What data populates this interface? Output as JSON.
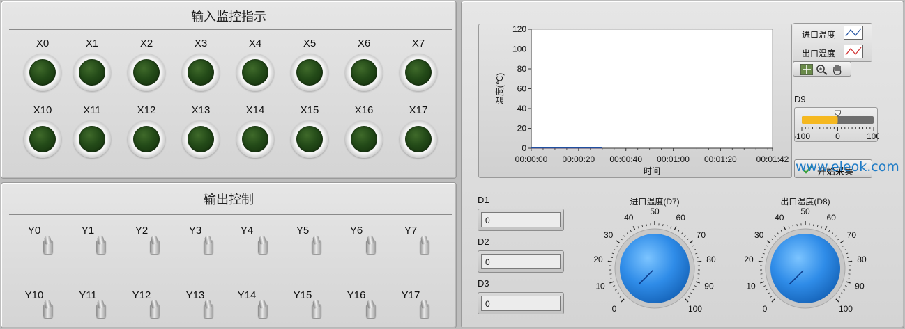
{
  "input_panel": {
    "title": "输入监控指示",
    "leds_row1": [
      "X0",
      "X1",
      "X2",
      "X3",
      "X4",
      "X5",
      "X6",
      "X7"
    ],
    "leds_row2": [
      "X10",
      "X11",
      "X12",
      "X13",
      "X14",
      "X15",
      "X16",
      "X17"
    ],
    "led_state": "off",
    "led_color": "#234a18"
  },
  "output_panel": {
    "title": "输出控制",
    "switches_row1": [
      "Y0",
      "Y1",
      "Y2",
      "Y3",
      "Y4",
      "Y5",
      "Y6",
      "Y7"
    ],
    "switches_row2": [
      "Y10",
      "Y11",
      "Y12",
      "Y13",
      "Y14",
      "Y15",
      "Y16",
      "Y17"
    ]
  },
  "chart_data": {
    "type": "line",
    "ylabel": "温度(℃)",
    "xlabel": "时间",
    "ylim": [
      0,
      120
    ],
    "yticks": [
      "0",
      "20",
      "40",
      "60",
      "80",
      "100",
      "120"
    ],
    "xlim_seconds": [
      0,
      102
    ],
    "xticks": [
      "00:00:00",
      "00:00:20",
      "00:00:40",
      "00:01:00",
      "00:01:20",
      "00:01:42"
    ],
    "xtick_seconds": [
      0,
      20,
      40,
      60,
      80,
      102
    ],
    "series": [
      {
        "name": "进口温度",
        "color": "#1f4fa0",
        "x": [
          0,
          30
        ],
        "y": [
          0,
          0
        ]
      },
      {
        "name": "出口温度",
        "color": "#d03030",
        "x": [
          0,
          30
        ],
        "y": [
          0,
          0
        ]
      }
    ],
    "grid": false,
    "legend": "right"
  },
  "slider_d9": {
    "label": "D9",
    "min": -100,
    "max": 100,
    "value": 0,
    "tick_labels": [
      "-100",
      "0",
      "100"
    ],
    "fill_color": "#f5b820"
  },
  "start_button": {
    "label": "开始采集",
    "icon": "check-icon"
  },
  "numeric": [
    {
      "label": "D1",
      "value": "0"
    },
    {
      "label": "D2",
      "value": "0"
    },
    {
      "label": "D3",
      "value": "0"
    }
  ],
  "knob_inlet": {
    "label": "进口温度(D7)",
    "min": 0,
    "max": 100,
    "value": 0,
    "scale": [
      "0",
      "10",
      "20",
      "30",
      "40",
      "50",
      "60",
      "70",
      "80",
      "90",
      "100"
    ]
  },
  "knob_outlet": {
    "label": "出口温度(D8)",
    "min": 0,
    "max": 100,
    "value": 0,
    "scale": [
      "0",
      "10",
      "20",
      "30",
      "40",
      "50",
      "60",
      "70",
      "80",
      "90",
      "100"
    ]
  },
  "watermark": "www.eleok.com",
  "colors": {
    "knob": "#2f8ce8",
    "accent_blue": "#1e7bc6"
  }
}
